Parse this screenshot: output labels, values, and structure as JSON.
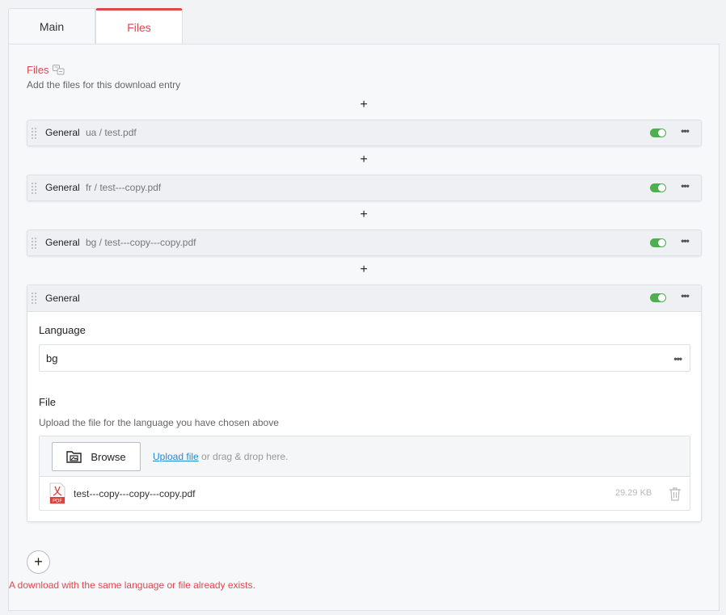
{
  "tabs": [
    {
      "label": "Main",
      "active": false
    },
    {
      "label": "Files",
      "active": true
    }
  ],
  "section": {
    "title": "Files",
    "description": "Add the files for this download entry"
  },
  "add_symbol": "+",
  "entries": [
    {
      "type": "General",
      "subtitle": "ua / test.pdf",
      "enabled": true
    },
    {
      "type": "General",
      "subtitle": "fr / test---copy.pdf",
      "enabled": true
    },
    {
      "type": "General",
      "subtitle": "bg / test---copy---copy.pdf",
      "enabled": true
    }
  ],
  "expanded_entry": {
    "type": "General",
    "enabled": true,
    "language_label": "Language",
    "language_value": "bg",
    "file_label": "File",
    "file_description": "Upload the file for the language you have chosen above",
    "browse_label": "Browse",
    "upload_link": "Upload file",
    "upload_hint": " or drag & drop here.",
    "file": {
      "name": "test---copy---copy---copy.pdf",
      "size": "29.29 KB",
      "icon_text": "PDF"
    }
  },
  "error_message": "A download with the same language or file already exists.",
  "colors": {
    "accent": "#e0474c",
    "toggle_on": "#4caf50",
    "link": "#1e8ad6"
  }
}
